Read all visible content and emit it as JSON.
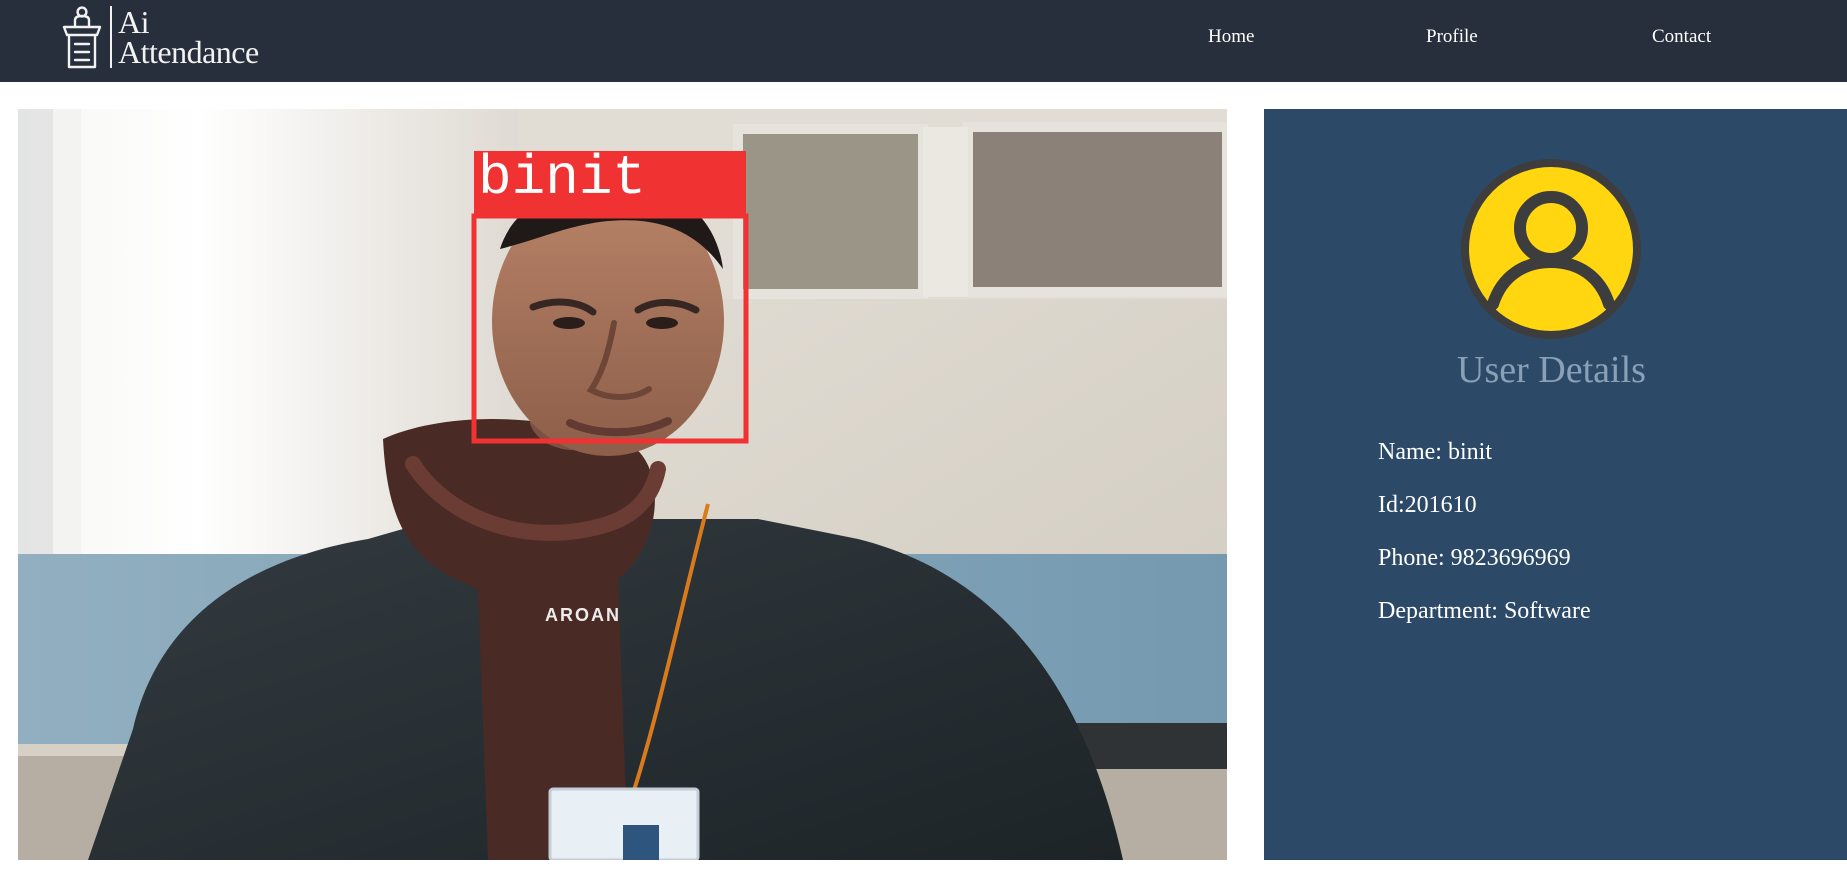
{
  "app": {
    "logo_line1": "Ai",
    "logo_line2": "Attendance"
  },
  "nav": {
    "items": [
      {
        "label": "Home"
      },
      {
        "label": "Profile"
      },
      {
        "label": "Contact"
      }
    ]
  },
  "camera": {
    "detection_label": "binit",
    "box_color": "#f03232",
    "hoodie_text": "AROAN"
  },
  "user_panel": {
    "title": "User Details",
    "name_label": "Name:",
    "name_value": "binit",
    "id_label": "Id:",
    "id_value": "201610",
    "phone_label": "Phone:",
    "phone_value": "9823696969",
    "department_label": "Department:",
    "department_value": "Software",
    "avatar_icon": "user-avatar-icon"
  },
  "colors": {
    "navbar": "#262f3b",
    "panel": "#2c4a68",
    "panel_title": "#8aa0b7",
    "avatar": "#ffd60f",
    "avatar_outline": "#3d3d3d"
  }
}
